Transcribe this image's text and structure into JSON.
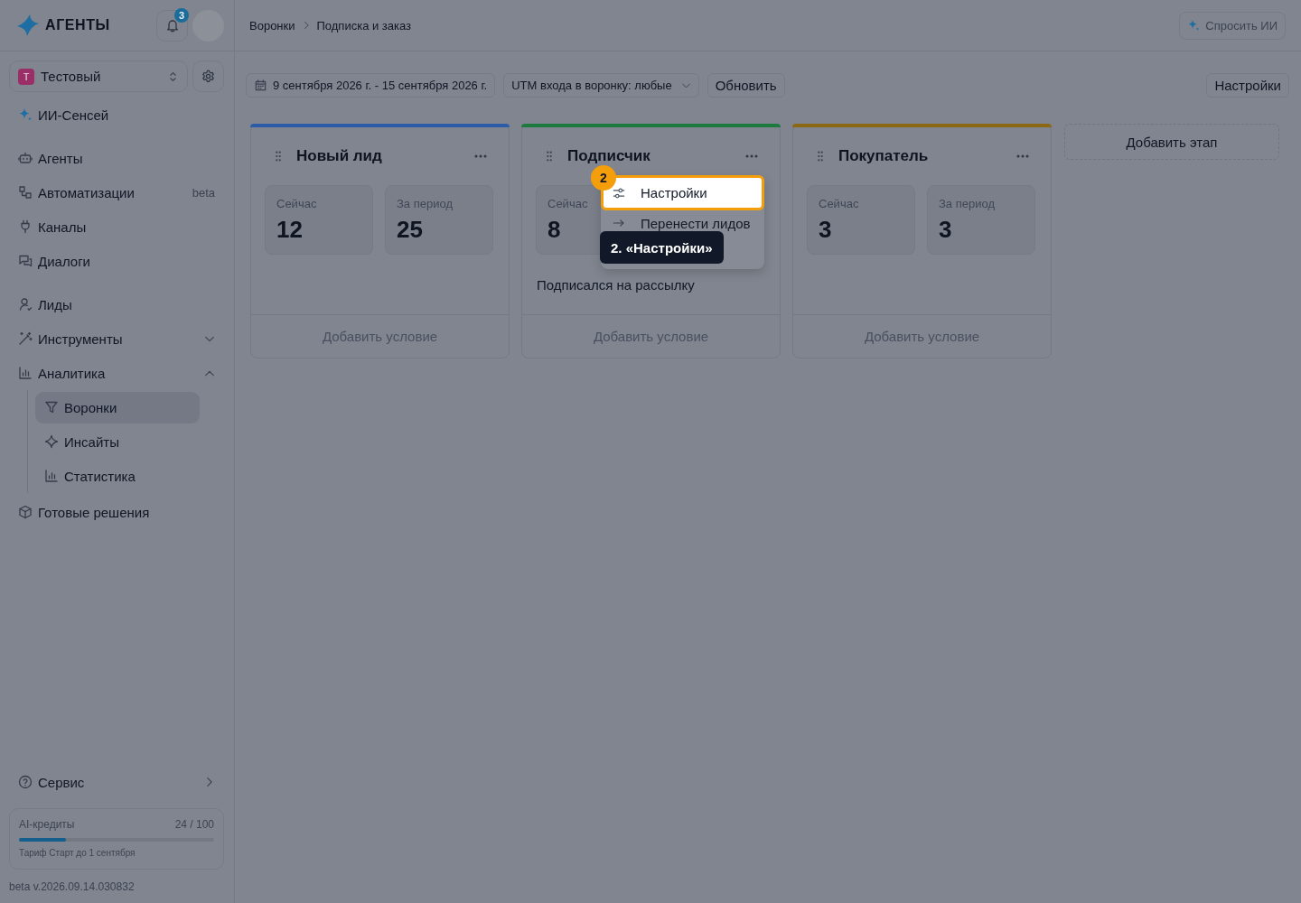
{
  "sidebar": {
    "logo": "АГЕНТЫ",
    "notification_count": "3",
    "workspace": {
      "initial": "Т",
      "name": "Тестовый"
    },
    "nav_sections": [
      {
        "items": [
          {
            "label": "ИИ-Сенсей",
            "selected": false
          }
        ]
      },
      {
        "items": [
          {
            "label": "Агенты",
            "selected": false
          },
          {
            "label": "Автоматизации",
            "badge": "beta",
            "selected": false
          },
          {
            "label": "Каналы",
            "selected": false
          },
          {
            "label": "Диалоги",
            "selected": false
          }
        ]
      },
      {
        "items": [
          {
            "label": "Лиды",
            "selected": false
          },
          {
            "label": "Инструменты",
            "expanded": false,
            "selected": false
          },
          {
            "label": "Аналитика",
            "expanded": true,
            "selected": false,
            "children": [
              {
                "label": "Воронки",
                "selected": true
              },
              {
                "label": "Инсайты",
                "selected": false
              },
              {
                "label": "Статистика",
                "selected": false
              }
            ]
          },
          {
            "label": "Готовые решения",
            "selected": false
          }
        ]
      }
    ],
    "service": {
      "label": "Сервис"
    },
    "credits": {
      "label": "AI-кредиты",
      "value": "24 / 100",
      "level": 0.24,
      "plan": "Тариф Старт до 1 сентября"
    },
    "version": "beta v.2026.09.14.030832"
  },
  "header": {
    "breadcrumbs": [
      {
        "label": "Воронки"
      },
      {
        "label": "Подписка и заказ"
      }
    ],
    "ask_ai": "Спросить ИИ"
  },
  "toolbar": {
    "date_range": "9 сентября 2026 г. - 15 сентября 2026 г.",
    "utm_filter": "UTM входа в воронку: любые",
    "refresh": "Обновить",
    "settings": "Настройки"
  },
  "stages": [
    {
      "title": "Новый лид",
      "color": "#2c5ba8",
      "stats": [
        {
          "label": "Сейчас",
          "value": "12"
        },
        {
          "label": "За период",
          "value": "25"
        }
      ],
      "add_condition": "Добавить условие"
    },
    {
      "title": "Подписчик",
      "color": "#1c7a3e",
      "stats": [
        {
          "label": "Сейчас",
          "value": "8"
        }
      ],
      "description": "Подписался на рассылку",
      "add_condition": "Добавить условие",
      "menu": {
        "items": [
          {
            "label": "Настройки",
            "highlighted": true
          },
          {
            "label": "Перенести лидов",
            "highlighted": false
          }
        ]
      }
    },
    {
      "title": "Покупатель",
      "color": "#8b6914",
      "stats": [
        {
          "label": "Сейчас",
          "value": "3"
        },
        {
          "label": "За период",
          "value": "3"
        }
      ],
      "add_condition": "Добавить условие"
    }
  ],
  "add_stage": "Добавить этап",
  "tutorial": {
    "step": "2",
    "tooltip": "2. «Настройки»"
  }
}
